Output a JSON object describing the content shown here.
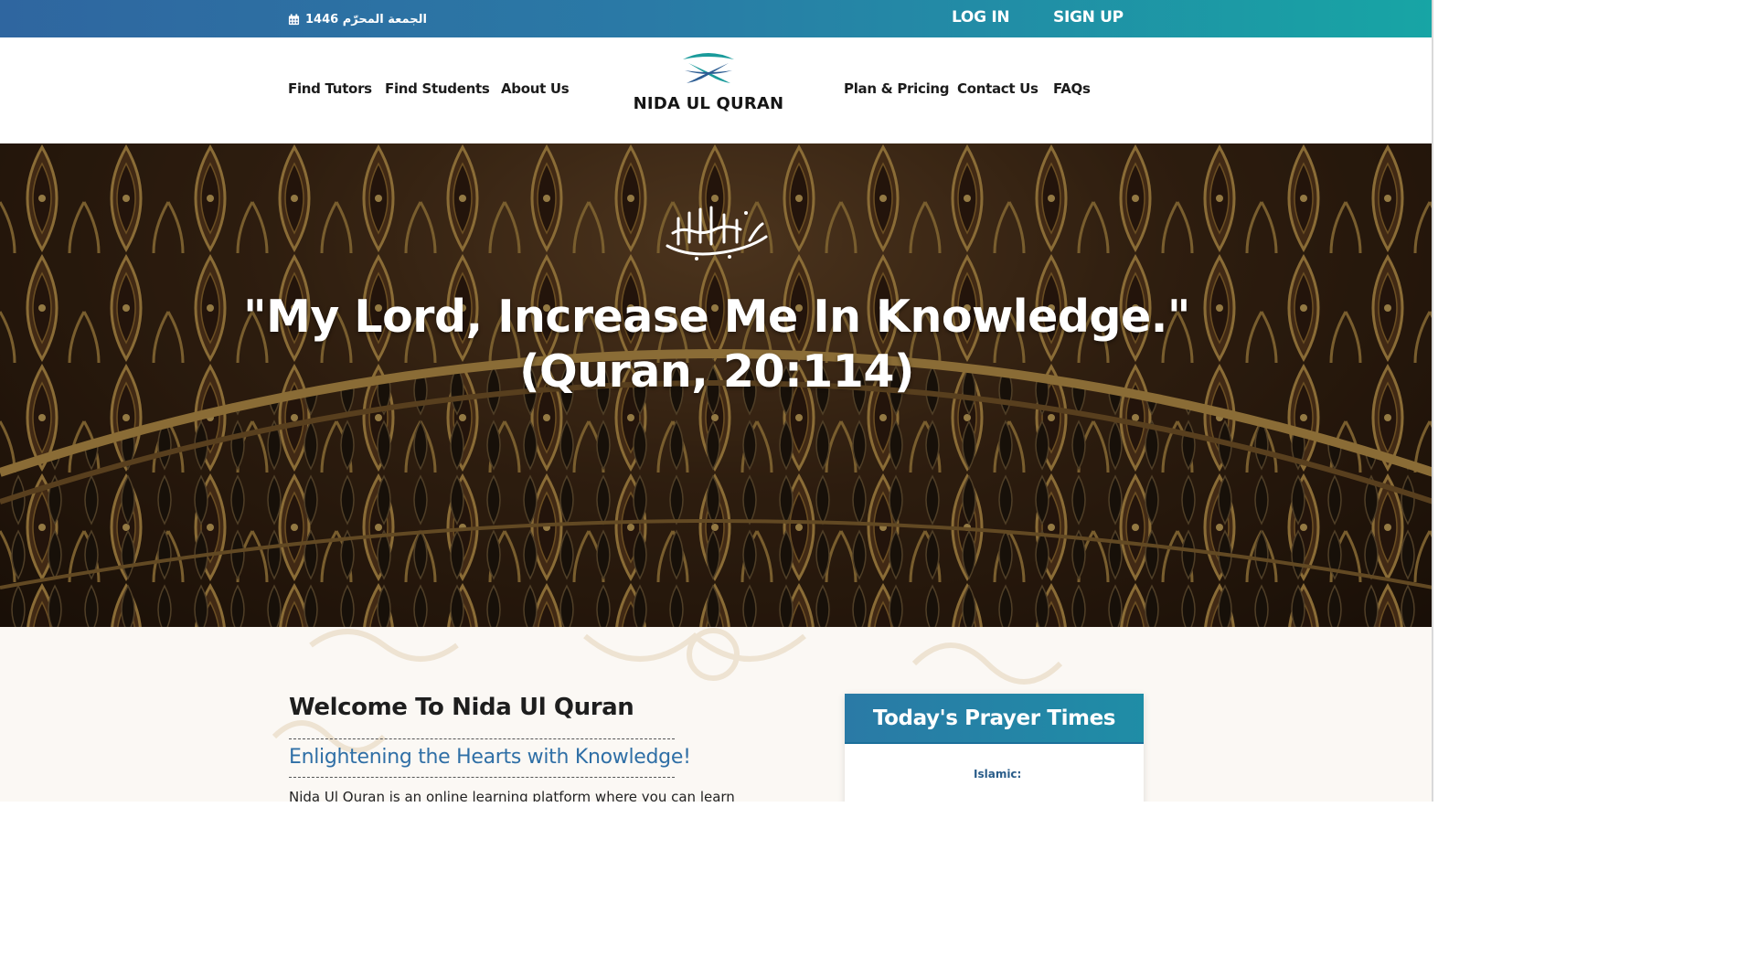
{
  "topbar": {
    "hijri_date": "الجمعة المحرّم 1446",
    "calendar_icon": "calendar-icon",
    "login": "LOG IN",
    "signup": "SIGN UP",
    "colors": {
      "gradient_start": "#2f66a0",
      "gradient_end": "#17a5a5"
    }
  },
  "nav": {
    "left_links": [
      "Find Tutors",
      "Find Students",
      "About Us"
    ],
    "right_links": [
      "Plan & Pricing",
      "Contact Us",
      "FAQs"
    ],
    "logo_text": "NIDA UL QURAN",
    "logo_icon": "open-book-icon",
    "logo_colors": {
      "teal": "#1a9b9b",
      "blue": "#2c5d93"
    }
  },
  "hero": {
    "calligraphy_icon": "bismillah-calligraphy",
    "quote_line1": "\"My Lord, Increase Me In Knowledge.\"",
    "quote_line2": "(Quran, 20:114)"
  },
  "main": {
    "welcome_title": "Welcome To Nida Ul Quran",
    "tagline": "Enlightening the Hearts with Knowledge!",
    "intro_text": "Nida Ul Quran is an online learning platform where you can learn",
    "accent_color": "#2f6fa6"
  },
  "prayer_times": {
    "title": "Today's Prayer Times",
    "label": "Islamic:"
  }
}
